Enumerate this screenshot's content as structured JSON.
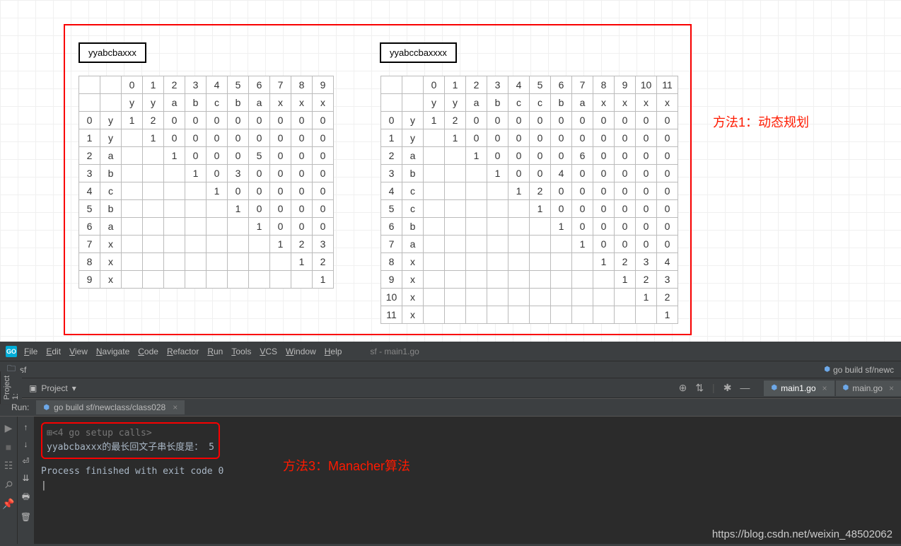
{
  "labels": {
    "str1": "yyabcbaxxx",
    "str2": "yyabccbaxxxx"
  },
  "annotation1": "方法1：动态规划",
  "annotation2": "方法3：Manacher算法",
  "table1": {
    "cols": [
      "0",
      "1",
      "2",
      "3",
      "4",
      "5",
      "6",
      "7",
      "8",
      "9"
    ],
    "colChars": [
      "y",
      "y",
      "a",
      "b",
      "c",
      "b",
      "a",
      "x",
      "x",
      "x"
    ],
    "rows": [
      {
        "i": "0",
        "c": "y",
        "v": [
          "1",
          "2",
          "0",
          "0",
          "0",
          "0",
          "0",
          "0",
          "0",
          "0"
        ]
      },
      {
        "i": "1",
        "c": "y",
        "v": [
          "",
          "1",
          "0",
          "0",
          "0",
          "0",
          "0",
          "0",
          "0",
          "0"
        ]
      },
      {
        "i": "2",
        "c": "a",
        "v": [
          "",
          "",
          "1",
          "0",
          "0",
          "0",
          "5",
          "0",
          "0",
          "0"
        ]
      },
      {
        "i": "3",
        "c": "b",
        "v": [
          "",
          "",
          "",
          "1",
          "0",
          "3",
          "0",
          "0",
          "0",
          "0"
        ]
      },
      {
        "i": "4",
        "c": "c",
        "v": [
          "",
          "",
          "",
          "",
          "1",
          "0",
          "0",
          "0",
          "0",
          "0"
        ]
      },
      {
        "i": "5",
        "c": "b",
        "v": [
          "",
          "",
          "",
          "",
          "",
          "1",
          "0",
          "0",
          "0",
          "0"
        ]
      },
      {
        "i": "6",
        "c": "a",
        "v": [
          "",
          "",
          "",
          "",
          "",
          "",
          "1",
          "0",
          "0",
          "0"
        ]
      },
      {
        "i": "7",
        "c": "x",
        "v": [
          "",
          "",
          "",
          "",
          "",
          "",
          "",
          "1",
          "2",
          "3"
        ]
      },
      {
        "i": "8",
        "c": "x",
        "v": [
          "",
          "",
          "",
          "",
          "",
          "",
          "",
          "",
          "1",
          "2"
        ]
      },
      {
        "i": "9",
        "c": "x",
        "v": [
          "",
          "",
          "",
          "",
          "",
          "",
          "",
          "",
          "",
          "1"
        ]
      }
    ]
  },
  "table2": {
    "cols": [
      "0",
      "1",
      "2",
      "3",
      "4",
      "5",
      "6",
      "7",
      "8",
      "9",
      "10",
      "11"
    ],
    "colChars": [
      "y",
      "y",
      "a",
      "b",
      "c",
      "c",
      "b",
      "a",
      "x",
      "x",
      "x",
      "x"
    ],
    "rows": [
      {
        "i": "0",
        "c": "y",
        "v": [
          "1",
          "2",
          "0",
          "0",
          "0",
          "0",
          "0",
          "0",
          "0",
          "0",
          "0",
          "0"
        ]
      },
      {
        "i": "1",
        "c": "y",
        "v": [
          "",
          "1",
          "0",
          "0",
          "0",
          "0",
          "0",
          "0",
          "0",
          "0",
          "0",
          "0"
        ]
      },
      {
        "i": "2",
        "c": "a",
        "v": [
          "",
          "",
          "1",
          "0",
          "0",
          "0",
          "0",
          "6",
          "0",
          "0",
          "0",
          "0"
        ]
      },
      {
        "i": "3",
        "c": "b",
        "v": [
          "",
          "",
          "",
          "1",
          "0",
          "0",
          "4",
          "0",
          "0",
          "0",
          "0",
          "0"
        ]
      },
      {
        "i": "4",
        "c": "c",
        "v": [
          "",
          "",
          "",
          "",
          "1",
          "2",
          "0",
          "0",
          "0",
          "0",
          "0",
          "0"
        ]
      },
      {
        "i": "5",
        "c": "c",
        "v": [
          "",
          "",
          "",
          "",
          "",
          "1",
          "0",
          "0",
          "0",
          "0",
          "0",
          "0"
        ]
      },
      {
        "i": "6",
        "c": "b",
        "v": [
          "",
          "",
          "",
          "",
          "",
          "",
          "1",
          "0",
          "0",
          "0",
          "0",
          "0"
        ]
      },
      {
        "i": "7",
        "c": "a",
        "v": [
          "",
          "",
          "",
          "",
          "",
          "",
          "",
          "1",
          "0",
          "0",
          "0",
          "0"
        ]
      },
      {
        "i": "8",
        "c": "x",
        "v": [
          "",
          "",
          "",
          "",
          "",
          "",
          "",
          "",
          "1",
          "2",
          "3",
          "4"
        ]
      },
      {
        "i": "9",
        "c": "x",
        "v": [
          "",
          "",
          "",
          "",
          "",
          "",
          "",
          "",
          "",
          "1",
          "2",
          "3"
        ]
      },
      {
        "i": "10",
        "c": "x",
        "v": [
          "",
          "",
          "",
          "",
          "",
          "",
          "",
          "",
          "",
          "",
          "1",
          "2"
        ]
      },
      {
        "i": "11",
        "c": "x",
        "v": [
          "",
          "",
          "",
          "",
          "",
          "",
          "",
          "",
          "",
          "",
          "",
          "1"
        ]
      }
    ]
  },
  "ide": {
    "menus": [
      "File",
      "Edit",
      "View",
      "Navigate",
      "Code",
      "Refactor",
      "Run",
      "Tools",
      "VCS",
      "Window",
      "Help"
    ],
    "titlePath": "sf - main1.go",
    "breadcrumb": "sf",
    "runConfig": "go build sf/newc",
    "projectLabel": "Project",
    "tabs": [
      {
        "name": "main1.go",
        "active": true
      },
      {
        "name": "main.go",
        "active": false
      }
    ],
    "runLabel": "Run:",
    "runTab": "go build sf/newclass/class028",
    "console": {
      "line1": "<4 go setup calls>",
      "line2": "yyabcbaxxx的最长回文子串长度是： 5",
      "line3": "Process finished with exit code 0"
    },
    "sideTab": "1: Project"
  },
  "watermark": "https://blog.csdn.net/weixin_48502062"
}
